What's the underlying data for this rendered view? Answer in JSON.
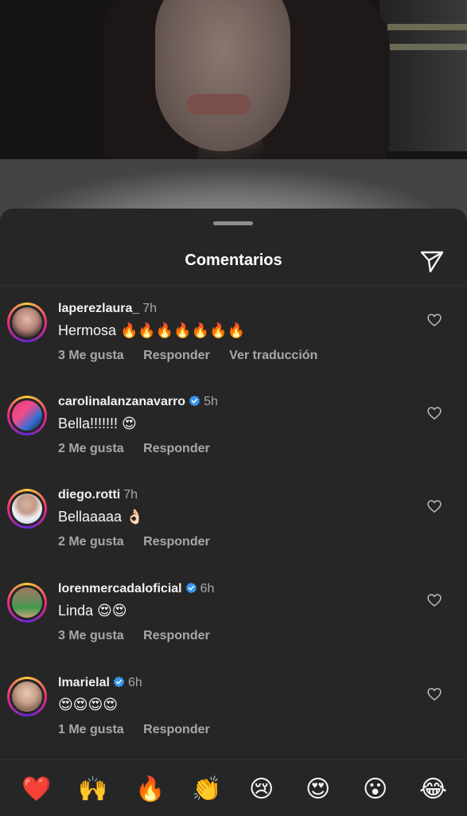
{
  "sheet": {
    "title": "Comentarios"
  },
  "comments": [
    {
      "username": "laperezlaura_",
      "verified": false,
      "time": "7h",
      "text": "Hermosa 🔥🔥🔥🔥🔥🔥🔥",
      "likes": "3 Me gusta",
      "reply": "Responder",
      "translate": "Ver traducción"
    },
    {
      "username": "carolinalanzanavarro",
      "verified": true,
      "time": "5h",
      "text": "Bella!!!!!!! 😍",
      "likes": "2 Me gusta",
      "reply": "Responder"
    },
    {
      "username": "diego.rotti",
      "verified": false,
      "time": "7h",
      "text": "Bellaaaaa 👌🏻",
      "likes": "2 Me gusta",
      "reply": "Responder"
    },
    {
      "username": "lorenmercadaloficial",
      "verified": true,
      "time": "6h",
      "text": "Linda 😍😍",
      "likes": "3 Me gusta",
      "reply": "Responder"
    },
    {
      "username": "lmarielal",
      "verified": true,
      "time": "6h",
      "text": "😍😍😍😍",
      "likes": "1 Me gusta",
      "reply": "Responder"
    }
  ],
  "emoji_bar": [
    "❤️",
    "🙌",
    "🔥",
    "👏",
    "😢",
    "😍",
    "😮",
    "😂"
  ],
  "colors": {
    "sheet_bg": "#262626",
    "muted_text": "#a8a8a8",
    "verified_blue": "#3897f0"
  }
}
